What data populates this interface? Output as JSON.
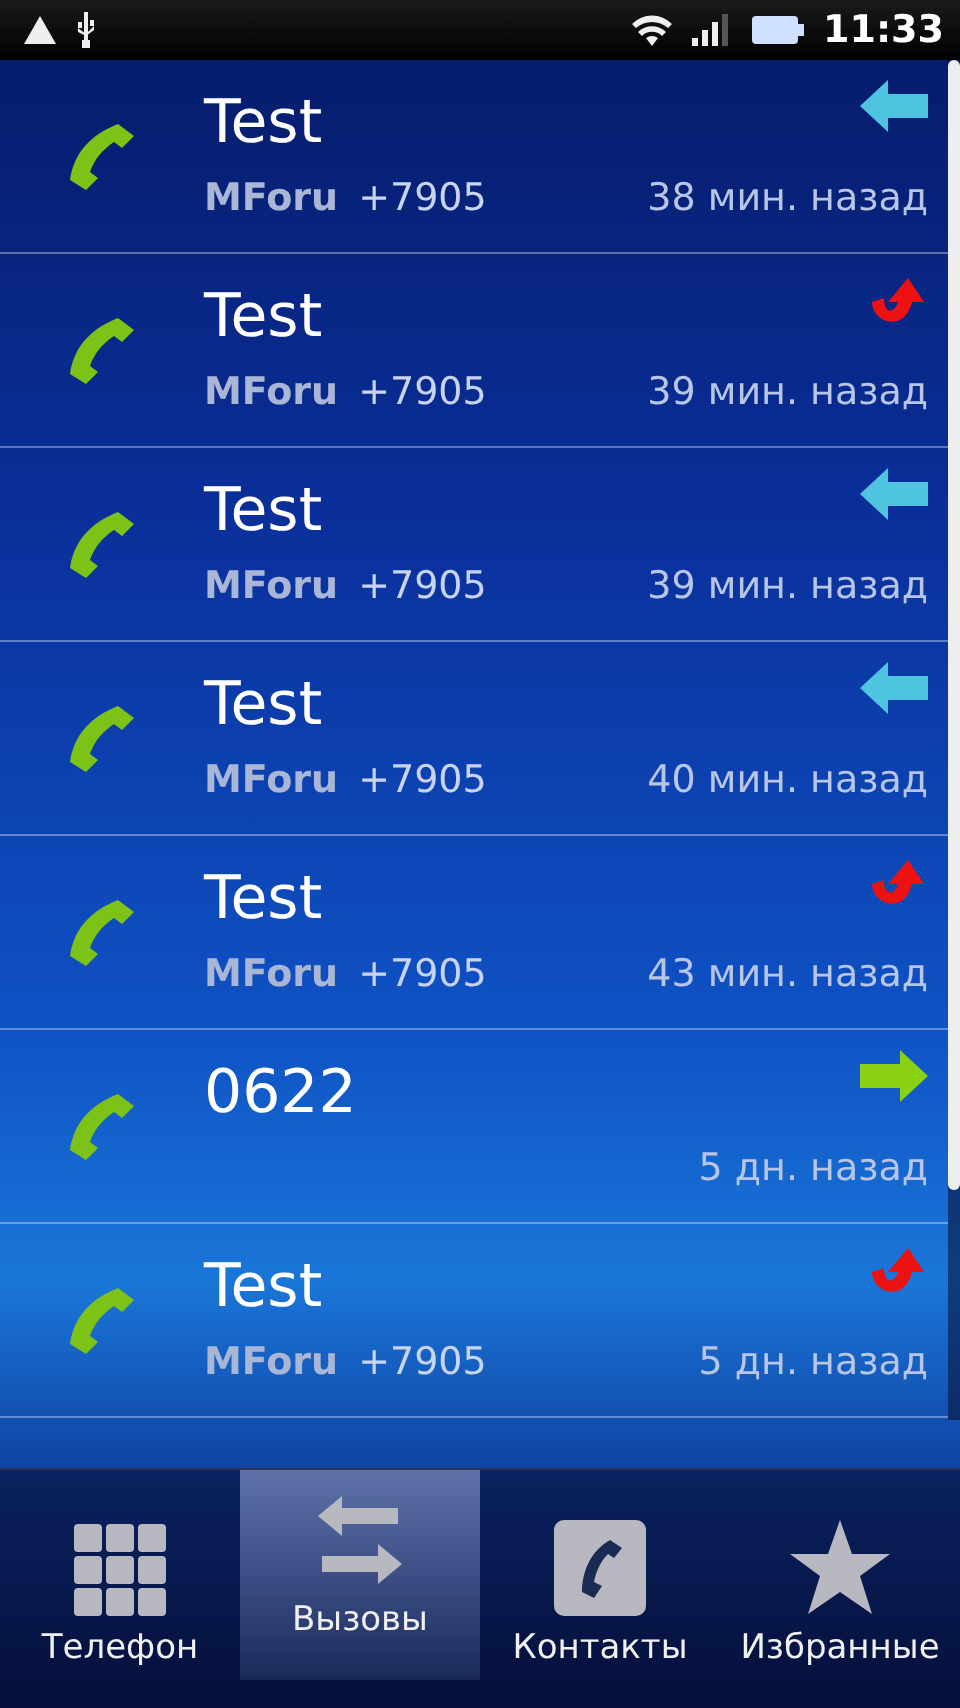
{
  "status_bar": {
    "time": "11:33"
  },
  "calls": [
    {
      "name": "Test",
      "account": "MForu",
      "number": "+7905",
      "time": "38 мин. назад",
      "kind": "incoming"
    },
    {
      "name": "Test",
      "account": "MForu",
      "number": "+7905",
      "time": "39 мин. назад",
      "kind": "missed"
    },
    {
      "name": "Test",
      "account": "MForu",
      "number": "+7905",
      "time": "39 мин. назад",
      "kind": "incoming"
    },
    {
      "name": "Test",
      "account": "MForu",
      "number": "+7905",
      "time": "40 мин. назад",
      "kind": "incoming"
    },
    {
      "name": "Test",
      "account": "MForu",
      "number": "+7905",
      "time": "43 мин. назад",
      "kind": "missed"
    },
    {
      "name": "0622",
      "time": "5 дн. назад",
      "kind": "outgoing"
    },
    {
      "name": "Test",
      "account": "MForu",
      "number": "+7905",
      "time": "5 дн. назад",
      "kind": "missed"
    }
  ],
  "tabs": [
    {
      "label": "Телефон",
      "kind": "keypad",
      "selected": false
    },
    {
      "label": "Вызовы",
      "kind": "calls",
      "selected": true
    },
    {
      "label": "Контакты",
      "kind": "contacts",
      "selected": false
    },
    {
      "label": "Избранные",
      "kind": "star",
      "selected": false
    }
  ]
}
